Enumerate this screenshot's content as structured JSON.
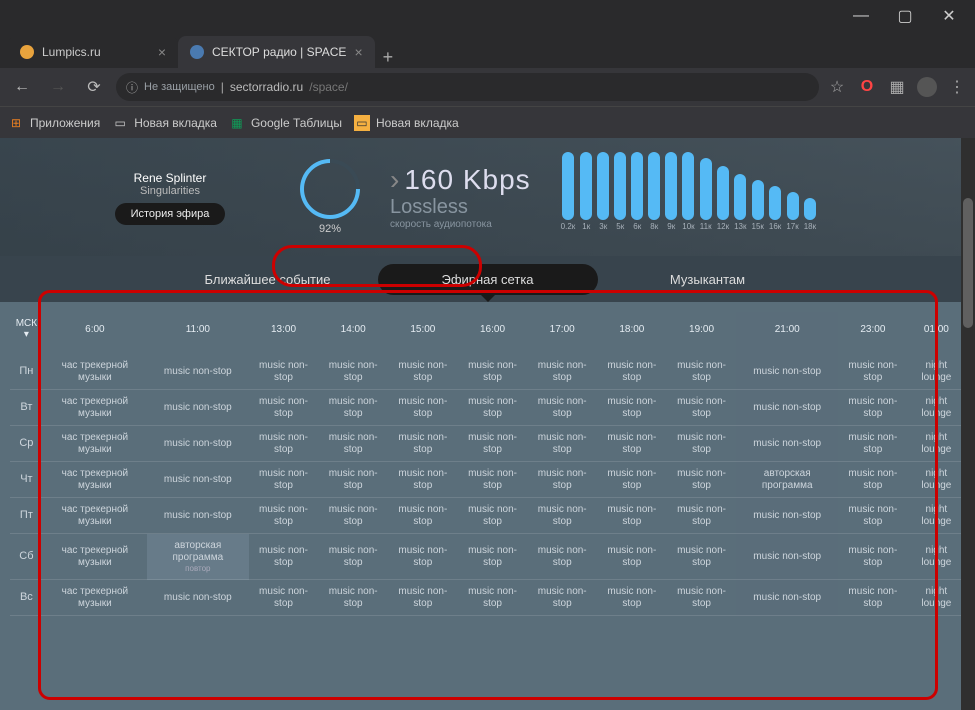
{
  "tabs": [
    {
      "title": "Lumpics.ru",
      "favicon": "#e8a33d",
      "active": false
    },
    {
      "title": "СЕКТОР радио | SPACE",
      "favicon": "#4a7ab0",
      "active": true
    }
  ],
  "addr": {
    "secure": "Не защищено",
    "host": "sectorradio.ru",
    "path": "/space/"
  },
  "bookmarks": {
    "apps": "Приложения",
    "items": [
      "Новая вкладка",
      "Google Таблицы",
      "Новая вкладка"
    ]
  },
  "nowplaying": {
    "artist": "Rene Splinter",
    "track": "Singularities",
    "history_btn": "История эфира"
  },
  "volume": {
    "pct": "92%"
  },
  "stream": {
    "kbps": "160 Kbps",
    "lossless": "Lossless",
    "label": "скорость аудиопотока"
  },
  "eq": {
    "labels": [
      "0.2к",
      "1к",
      "3к",
      "5к",
      "6к",
      "8к",
      "9к",
      "10к",
      "11к",
      "12к",
      "13к",
      "15к",
      "16к",
      "17к",
      "18к"
    ],
    "heights": [
      68,
      68,
      68,
      68,
      68,
      68,
      68,
      68,
      62,
      54,
      46,
      40,
      34,
      28,
      22
    ]
  },
  "tabnav": {
    "items": [
      "Ближайшее событие",
      "Эфирная сетка",
      "Музыкантам"
    ],
    "active": 1
  },
  "schedule": {
    "tz": "МСК",
    "hours": [
      "6:00",
      "11:00",
      "13:00",
      "14:00",
      "15:00",
      "16:00",
      "17:00",
      "18:00",
      "19:00",
      "21:00",
      "23:00",
      "01:00"
    ],
    "days": [
      "Пн",
      "Вт",
      "Ср",
      "Чт",
      "Пт",
      "Сб",
      "Вс"
    ],
    "cell_tracker": "час трекерной музыки",
    "cell_nonstop": "music non-stop",
    "cell_night": "night lounge",
    "cell_author": "авторская программа",
    "cell_repeat": "повтор",
    "grid": [
      [
        "tracker",
        "nonstop",
        "nonstop",
        "nonstop",
        "nonstop",
        "nonstop",
        "nonstop",
        "nonstop",
        "nonstop",
        "nonstop",
        "nonstop",
        "night"
      ],
      [
        "tracker",
        "nonstop",
        "nonstop",
        "nonstop",
        "nonstop",
        "nonstop",
        "nonstop",
        "nonstop",
        "nonstop",
        "nonstop",
        "nonstop",
        "night"
      ],
      [
        "tracker",
        "nonstop",
        "nonstop",
        "nonstop",
        "nonstop",
        "nonstop",
        "nonstop",
        "nonstop",
        "nonstop",
        "nonstop",
        "nonstop",
        "night"
      ],
      [
        "tracker",
        "nonstop",
        "nonstop",
        "nonstop",
        "nonstop",
        "nonstop",
        "nonstop",
        "nonstop",
        "nonstop",
        "author",
        "nonstop",
        "night"
      ],
      [
        "tracker",
        "nonstop",
        "nonstop",
        "nonstop",
        "nonstop",
        "nonstop",
        "nonstop",
        "nonstop",
        "nonstop",
        "nonstop",
        "nonstop",
        "night"
      ],
      [
        "tracker",
        "author_r",
        "nonstop",
        "nonstop",
        "nonstop",
        "nonstop",
        "nonstop",
        "nonstop",
        "nonstop",
        "nonstop",
        "nonstop",
        "night"
      ],
      [
        "tracker",
        "nonstop",
        "nonstop",
        "nonstop",
        "nonstop",
        "nonstop",
        "nonstop",
        "nonstop",
        "nonstop",
        "nonstop",
        "nonstop",
        "night"
      ]
    ]
  }
}
